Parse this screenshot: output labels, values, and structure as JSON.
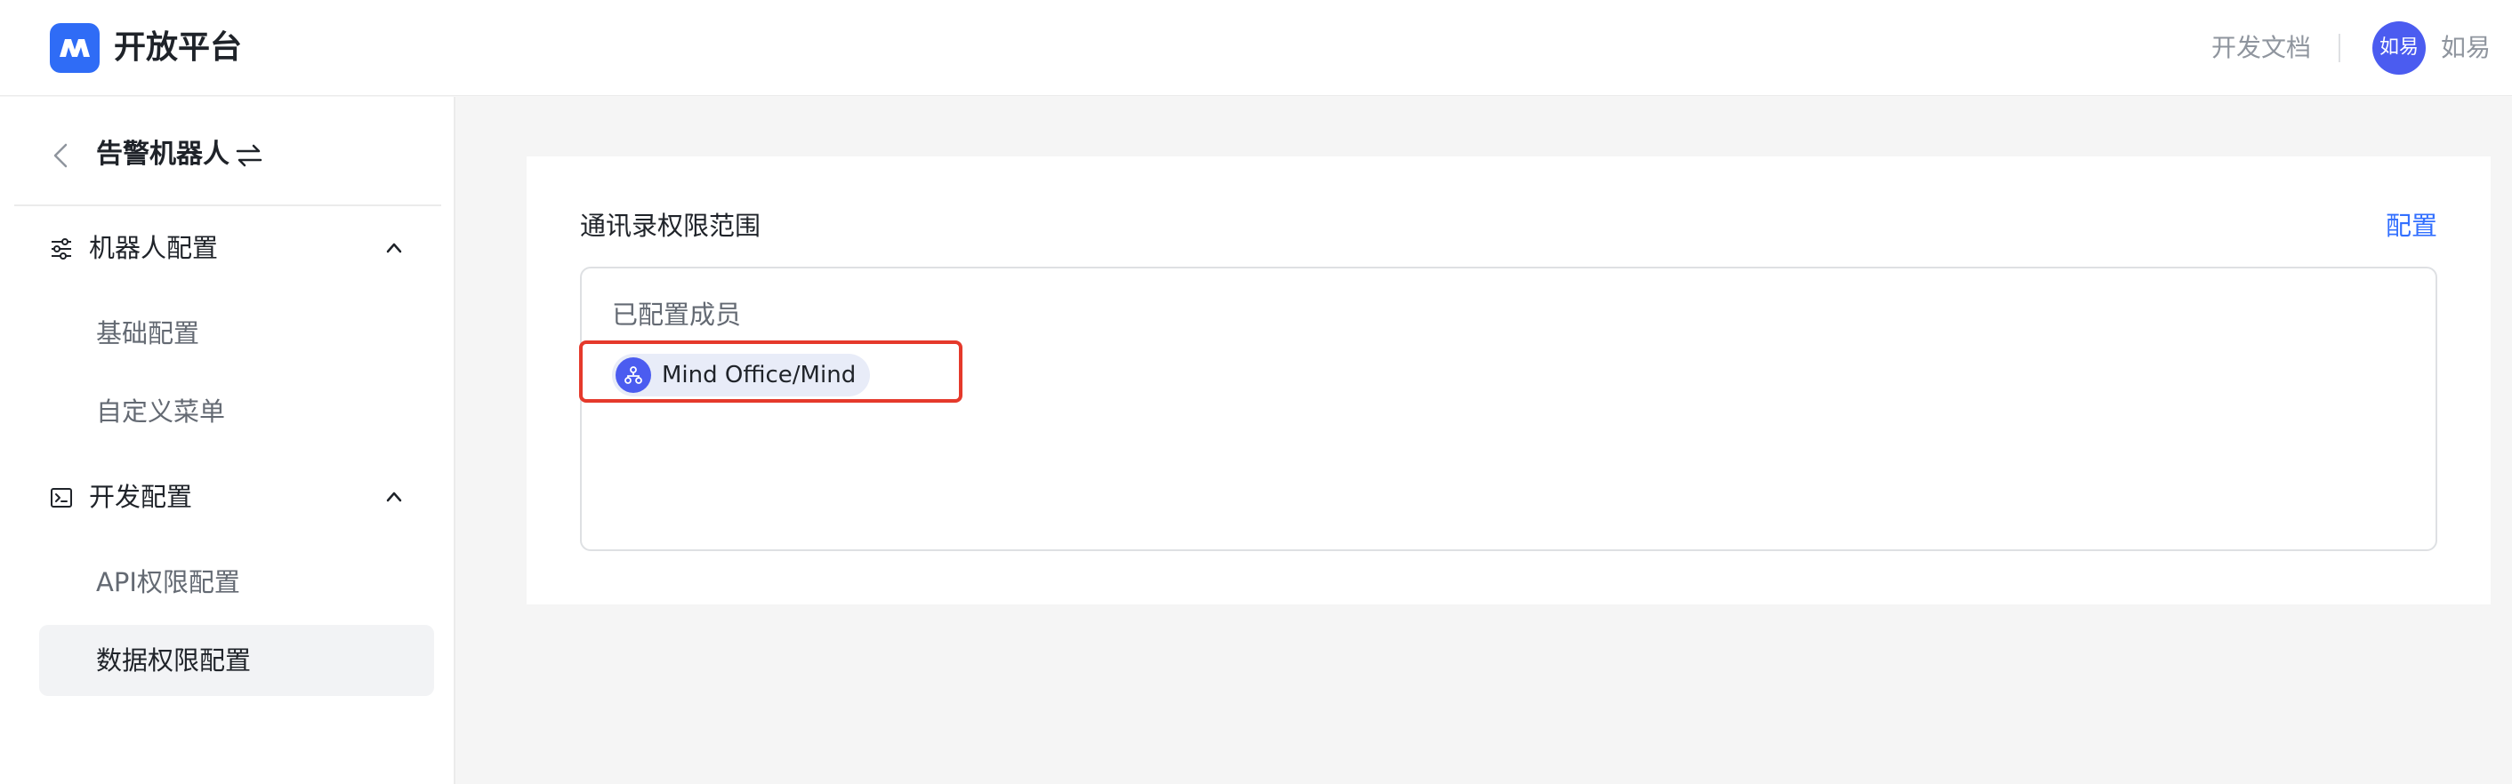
{
  "header": {
    "brand": "开放平台",
    "docs_link": "开发文档",
    "avatar_text": "如易",
    "username": "如易"
  },
  "sidebar": {
    "title": "告警机器人",
    "sections": [
      {
        "label": "机器人配置",
        "icon": "sliders-icon",
        "items": [
          "基础配置",
          "自定义菜单"
        ]
      },
      {
        "label": "开发配置",
        "icon": "terminal-icon",
        "items": [
          "API权限配置",
          "数据权限配置"
        ]
      }
    ],
    "active_item": "数据权限配置"
  },
  "main": {
    "section_title": "通讯录权限范围",
    "config_link": "配置",
    "configured_label": "已配置成员",
    "members": [
      {
        "name": "Mind Office/Mind",
        "icon": "org-chart-icon"
      }
    ]
  },
  "colors": {
    "accent": "#3370ff",
    "logo": "#2f6cf6",
    "avatar": "#4b5cf0",
    "highlight": "#e5392b"
  }
}
